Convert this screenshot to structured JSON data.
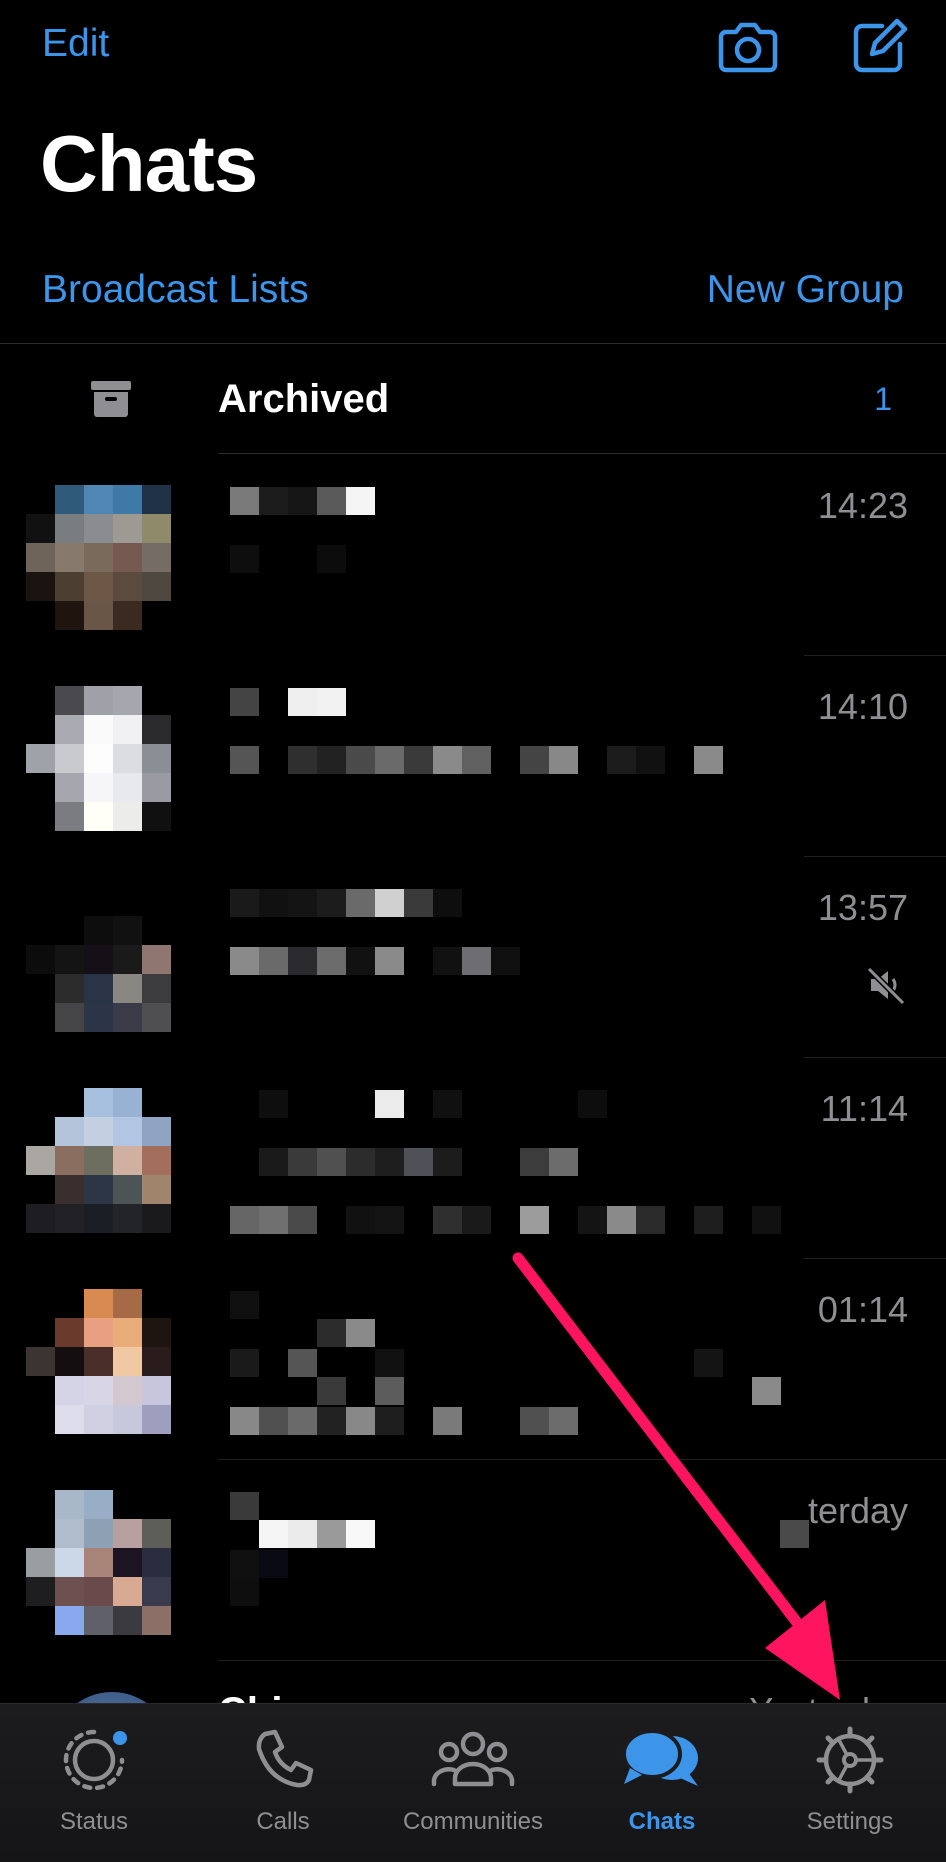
{
  "header": {
    "edit_label": "Edit",
    "camera_icon": "camera-icon",
    "compose_icon": "compose-icon",
    "title": "Chats"
  },
  "links": {
    "broadcast_label": "Broadcast Lists",
    "new_group_label": "New Group"
  },
  "archived": {
    "label": "Archived",
    "count": "1",
    "icon": "archive-box-icon"
  },
  "chats": [
    {
      "time": "14:23",
      "muted": false
    },
    {
      "time": "14:10",
      "muted": false
    },
    {
      "time": "13:57",
      "muted": true
    },
    {
      "time": "11:14",
      "muted": false
    },
    {
      "time": "01:14",
      "muted": false
    },
    {
      "time": "terday",
      "muted": false
    }
  ],
  "partial_chat": {
    "name": "Chisom",
    "date": "Yesterday"
  },
  "tabbar": {
    "tabs": [
      {
        "label": "Status",
        "icon": "status-ring-icon",
        "active": false
      },
      {
        "label": "Calls",
        "icon": "phone-icon",
        "active": false
      },
      {
        "label": "Communities",
        "icon": "people-icon",
        "active": false
      },
      {
        "label": "Chats",
        "icon": "chat-bubbles-icon",
        "active": true
      },
      {
        "label": "Settings",
        "icon": "gear-icon",
        "active": false
      }
    ]
  },
  "colors": {
    "accent": "#3d95ea",
    "annotation_arrow": "#ff1460",
    "muted_text": "#8e8e93"
  }
}
